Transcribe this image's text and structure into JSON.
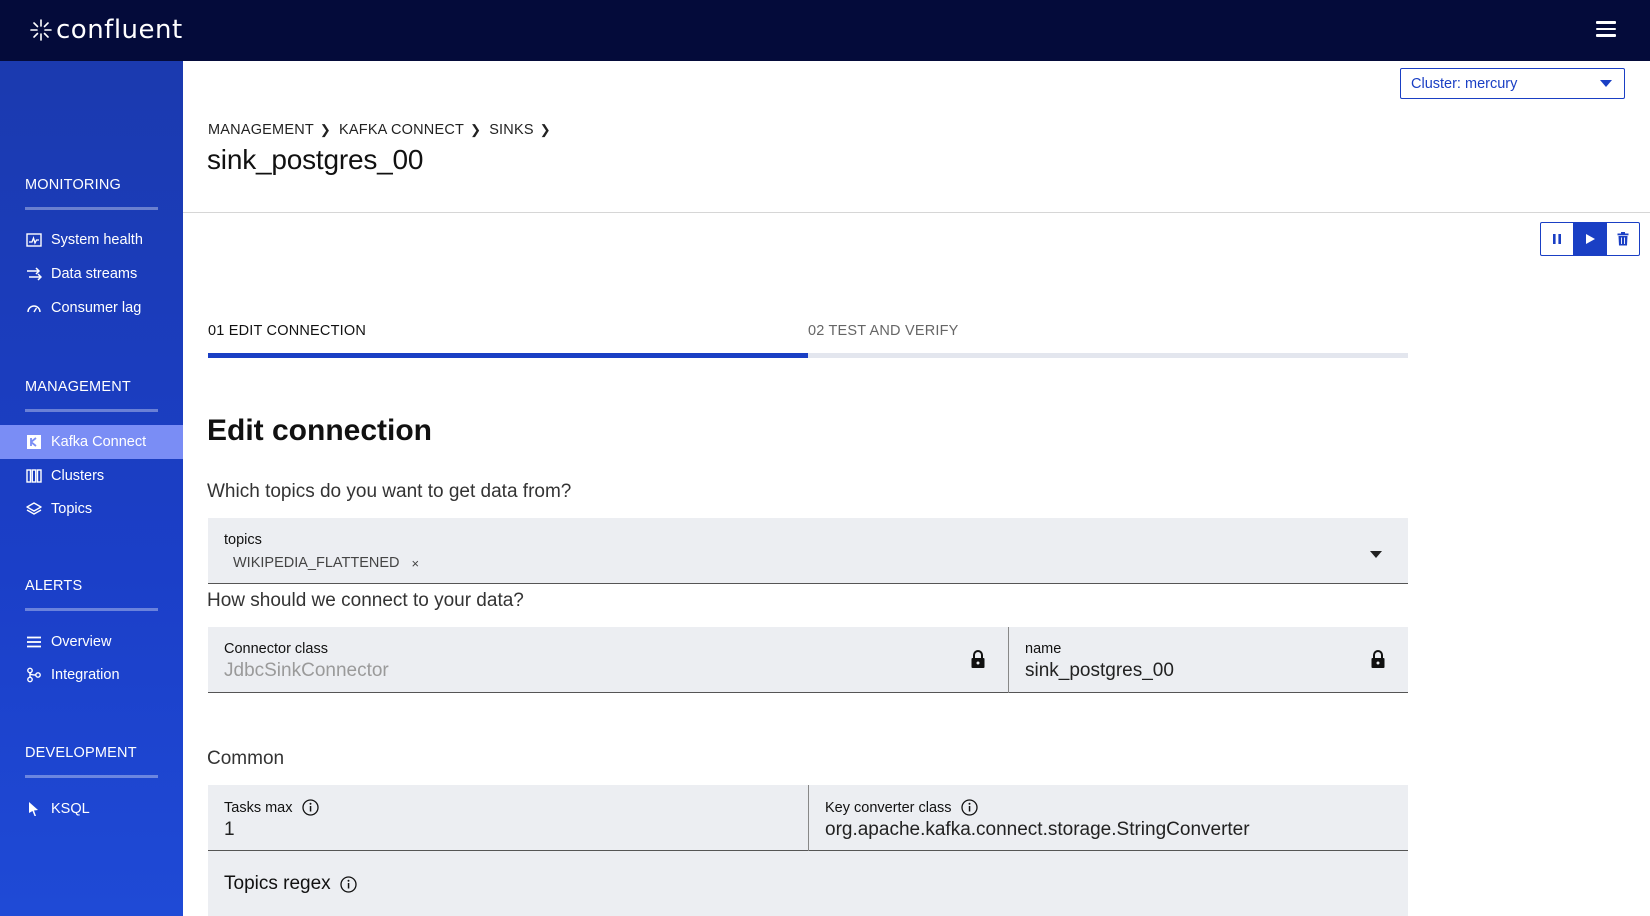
{
  "app": {
    "logo_text": "confluent"
  },
  "header": {
    "cluster_select": "Cluster: mercury"
  },
  "sidebar": {
    "sections": [
      {
        "heading": "MONITORING",
        "items": [
          {
            "label": "System health",
            "icon": "pulse-icon"
          },
          {
            "label": "Data streams",
            "icon": "streams-icon"
          },
          {
            "label": "Consumer lag",
            "icon": "gauge-icon"
          }
        ]
      },
      {
        "heading": "MANAGEMENT",
        "items": [
          {
            "label": "Kafka Connect",
            "icon": "connect-icon",
            "active": true
          },
          {
            "label": "Clusters",
            "icon": "clusters-icon"
          },
          {
            "label": "Topics",
            "icon": "layers-icon"
          }
        ]
      },
      {
        "heading": "ALERTS",
        "items": [
          {
            "label": "Overview",
            "icon": "list-icon"
          },
          {
            "label": "Integration",
            "icon": "integration-icon"
          }
        ]
      },
      {
        "heading": "DEVELOPMENT",
        "items": [
          {
            "label": "KSQL",
            "icon": "ksql-icon"
          }
        ]
      }
    ]
  },
  "breadcrumb": [
    "MANAGEMENT",
    "KAFKA CONNECT",
    "SINKS"
  ],
  "page_title": "sink_postgres_00",
  "steps": [
    {
      "label": "01 EDIT CONNECTION"
    },
    {
      "label": "02 TEST AND VERIFY"
    }
  ],
  "progress_fraction": 0.5,
  "form": {
    "title": "Edit connection",
    "topics_question": "Which topics do you want to get data from?",
    "topics_label": "topics",
    "topics_chip": "WIKIPEDIA_FLATTENED",
    "topics_chip_remove": "×",
    "connect_question": "How should we connect to your data?",
    "connector_class_label": "Connector class",
    "connector_class_value": "JdbcSinkConnector",
    "name_label": "name",
    "name_value": "sink_postgres_00",
    "common_heading": "Common",
    "tasks_max_label": "Tasks max",
    "tasks_max_value": "1",
    "key_converter_label": "Key converter class",
    "key_converter_value": "org.apache.kafka.connect.storage.StringConverter",
    "topics_regex_label": "Topics regex"
  },
  "colors": {
    "topbar": "#040b3a",
    "sidebar": "#1b3fc8",
    "accent": "#1a3fc4",
    "active_item": "#7a8df5"
  }
}
